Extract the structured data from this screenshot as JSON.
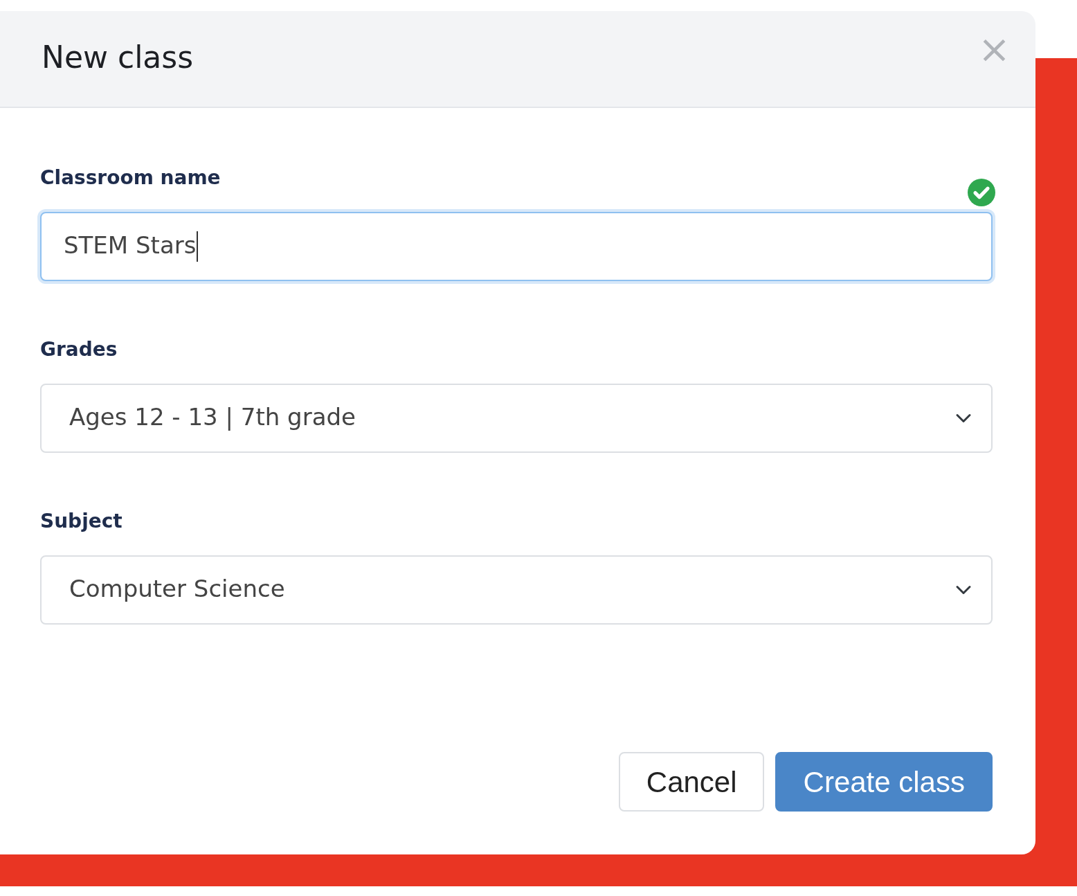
{
  "dialog": {
    "title": "New class",
    "close": "×"
  },
  "fields": [
    {
      "kind": "text",
      "label": "Classroom name",
      "value": "STEM Stars",
      "valid": true,
      "focused": true
    },
    {
      "kind": "select",
      "label": "Grades",
      "value": "Ages 12 - 13 | 7th grade",
      "valid": false,
      "focused": false
    },
    {
      "kind": "select",
      "label": "Subject",
      "value": "Computer Science",
      "valid": false,
      "focused": false
    }
  ],
  "buttons": [
    {
      "label": "Cancel",
      "kind": "secondary"
    },
    {
      "label": "Create class",
      "kind": "primary"
    }
  ]
}
